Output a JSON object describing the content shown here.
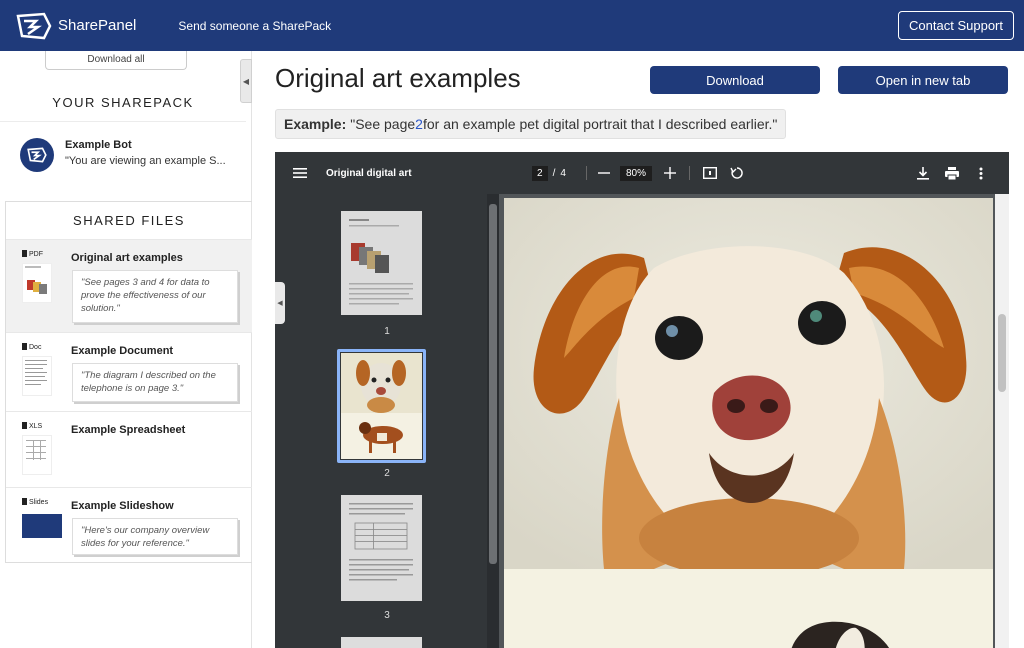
{
  "header": {
    "brand": "SharePanel",
    "tagline": "Send someone a SharePack",
    "support_label": "Contact Support"
  },
  "sidebar": {
    "download_all_label": "Download all",
    "sharepack_title": "YOUR SHAREPACK",
    "bot": {
      "name": "Example Bot",
      "message": "\"You are viewing an example S..."
    },
    "files_title": "SHARED FILES",
    "files": [
      {
        "tag": "PDF",
        "name": "Original art examples",
        "quote": "\"See pages 3 and 4 for data to prove the effectiveness of our solution.\"",
        "active": true
      },
      {
        "tag": "Doc",
        "name": "Example Document",
        "quote": "\"The diagram I described on the telephone is on page 3.\"",
        "active": false
      },
      {
        "tag": "XLS",
        "name": "Example Spreadsheet",
        "quote": "",
        "active": false
      },
      {
        "tag": "Slides",
        "name": "Example Slideshow",
        "quote": "\"Here's our company overview slides for your reference.\"",
        "active": false
      }
    ]
  },
  "main": {
    "title": "Original art examples",
    "download_label": "Download",
    "new_tab_label": "Open in new tab",
    "example": {
      "label": "Example:",
      "text_before": "\"See page ",
      "page_link": "2",
      "text_after": " for an example pet digital portrait that I described earlier.\""
    }
  },
  "viewer": {
    "doc_title": "Original digital art",
    "current_page": "2",
    "page_separator": "/",
    "total_pages": "4",
    "zoom": "80%",
    "thumbnails": [
      "1",
      "2",
      "3"
    ]
  },
  "colors": {
    "brand": "#1f3a7a",
    "viewer_toolbar": "#323639",
    "viewer_bg": "#525659",
    "selected_thumb": "#8ab4f8"
  }
}
